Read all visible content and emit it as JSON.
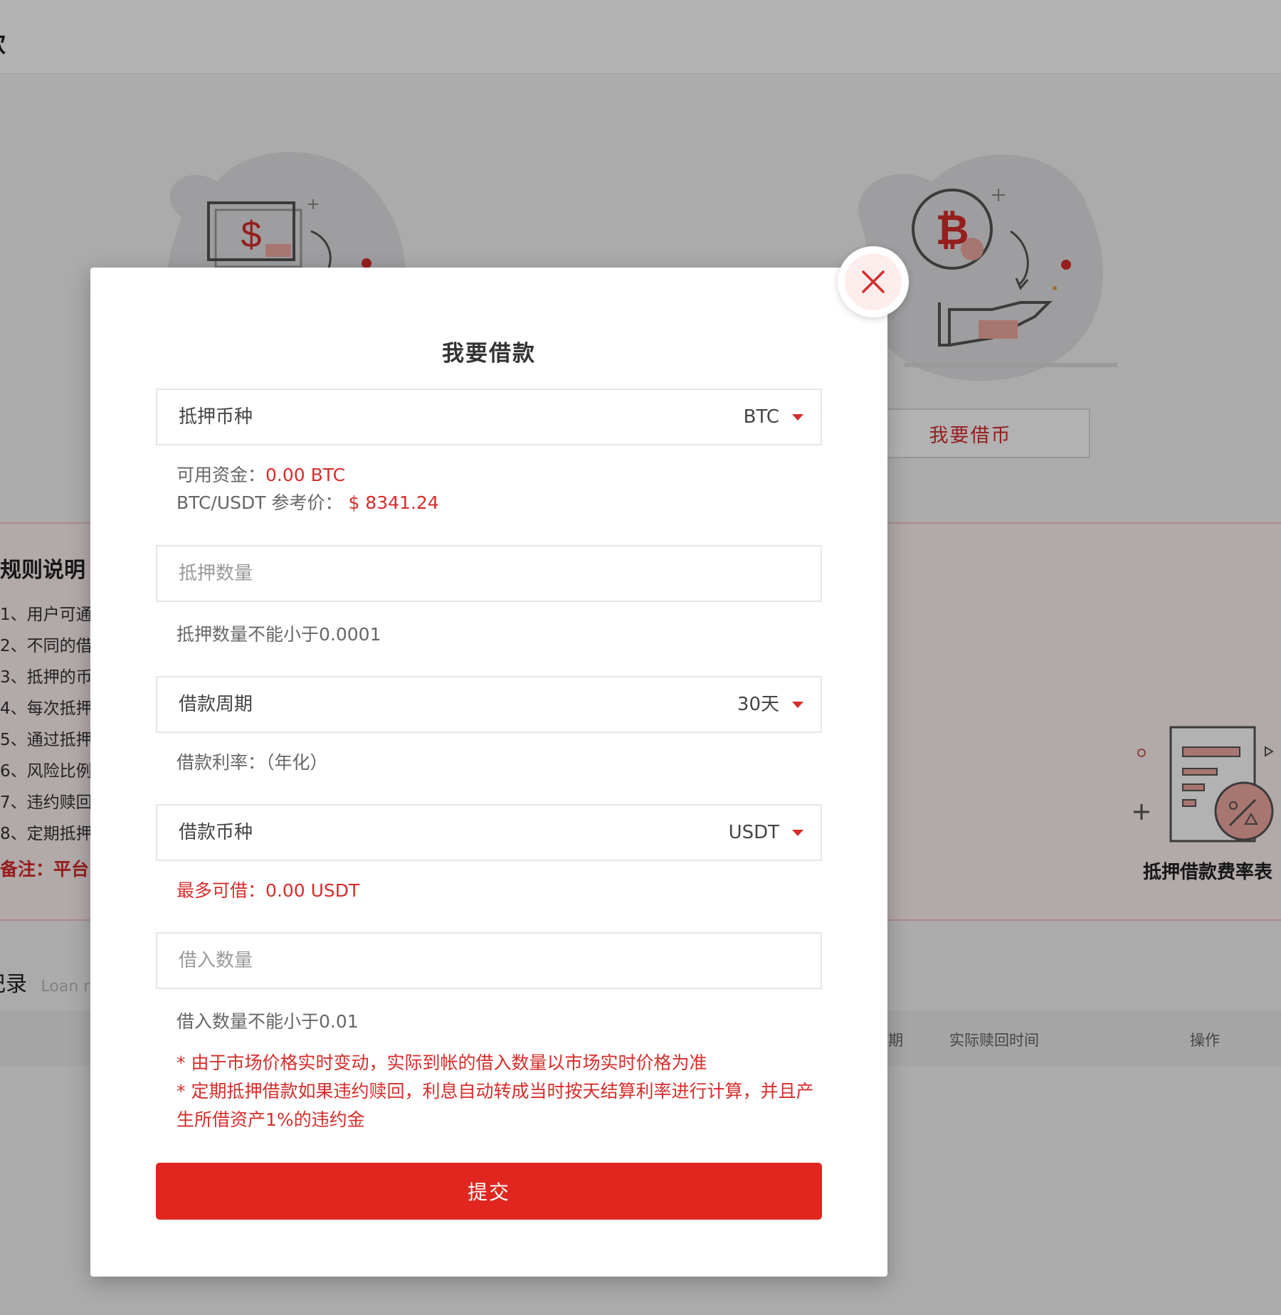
{
  "background": {
    "header_title": "款",
    "borrow_coin_button": "我要借币",
    "rules": {
      "title": "规则说明",
      "items": [
        "1、用户可通",
        "2、不同的借",
        "3、抵押的币",
        "4、每次抵押",
        "5、通过抵押",
        "6、风险比例",
        "7、违约赎回",
        "8、定期抵押"
      ],
      "note": "备注：平台"
    },
    "fee_table_link": "抵押借款费率表",
    "records": {
      "title": "记录",
      "subtitle": "Loan r"
    },
    "table_headers": [
      "期",
      "实际赎回时间",
      "操作"
    ]
  },
  "modal": {
    "title": "我要借款",
    "collateral_coin": {
      "label": "抵押币种",
      "value": "BTC"
    },
    "available_funds": {
      "label": "可用资金：",
      "value": "0.00 BTC"
    },
    "reference_price": {
      "label": "BTC/USDT 参考价：",
      "value": "$ 8341.24"
    },
    "collateral_amount": {
      "placeholder": "抵押数量",
      "hint": "抵押数量不能小于0.0001"
    },
    "loan_period": {
      "label": "借款周期",
      "value": "30天"
    },
    "loan_rate": {
      "label": "借款利率：",
      "value": "（年化）"
    },
    "loan_coin": {
      "label": "借款币种",
      "value": "USDT"
    },
    "max_borrow": {
      "label": "最多可借：",
      "value": "0.00 USDT"
    },
    "borrow_amount": {
      "placeholder": "借入数量",
      "hint": "借入数量不能小于0.01"
    },
    "warnings": [
      "* 由于市场价格实时变动，实际到帐的借入数量以市场实时价格为准",
      "* 定期抵押借款如果违约赎回，利息自动转成当时按天结算利率进行计算，并且产生所借资产1%的违约金"
    ],
    "submit_label": "提交"
  },
  "colors": {
    "accent": "#e0261f",
    "text_red": "#d62d2b",
    "overlay": "rgba(0,0,0,0.30)"
  },
  "icons": {
    "close": "close-icon",
    "caret": "caret-down-icon",
    "bitcoin": "bitcoin-icon",
    "dollar": "dollar-bill-icon",
    "fee_table": "fee-table-icon"
  }
}
